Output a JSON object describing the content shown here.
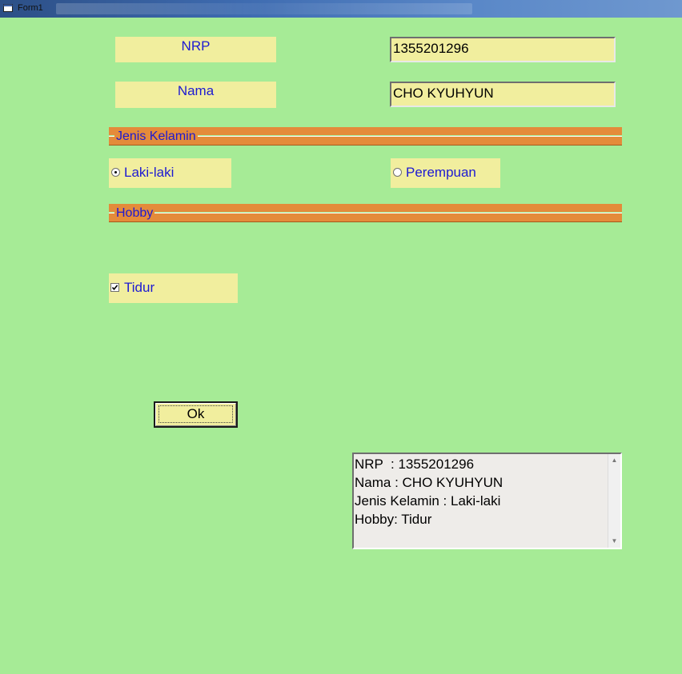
{
  "window": {
    "title": "Form1"
  },
  "form": {
    "nrp_label": "NRP",
    "nrp_value": "1355201296",
    "nama_label": "Nama",
    "nama_value": "CHO KYUHYUN"
  },
  "frames": {
    "gender_caption": "Jenis Kelamin",
    "hobby_caption": "Hobby"
  },
  "gender": {
    "options": [
      {
        "label": "Laki-laki",
        "selected": true
      },
      {
        "label": "Perempuan",
        "selected": false
      }
    ]
  },
  "hobby": {
    "options": [
      {
        "label": "Tidur",
        "checked": true
      }
    ]
  },
  "ok_button": {
    "label": "Ok"
  },
  "output": {
    "lines": [
      "NRP  : 1355201296",
      "Nama : CHO KYUHYUN",
      "Jenis Kelamin : Laki-laki",
      "Hobby: Tidur"
    ]
  },
  "colors": {
    "form_background": "#a6eb96",
    "control_background": "#f1ee9e",
    "frame_orange": "#e48b3a",
    "label_blue": "#1d1ad2"
  },
  "icons": {
    "app": "form-window-icon",
    "scroll_up": "scroll-up-arrow-icon",
    "scroll_down": "scroll-down-arrow-icon"
  }
}
